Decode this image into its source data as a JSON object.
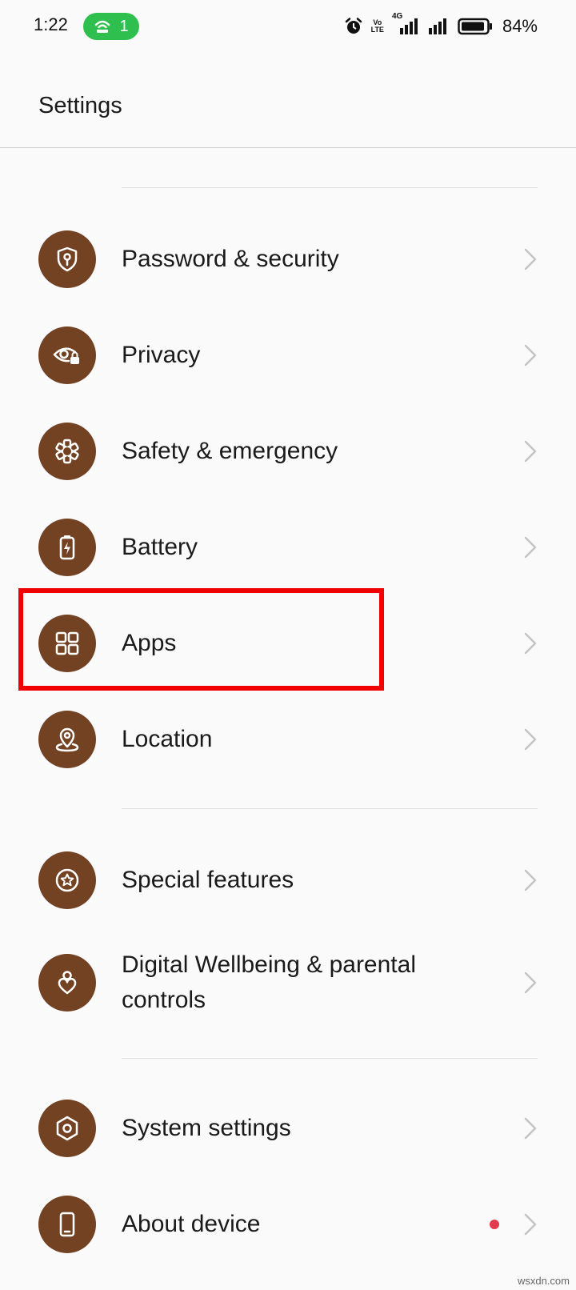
{
  "status_bar": {
    "time": "1:22",
    "hotspot_count": "1",
    "volte_top": "Vo",
    "volte_bottom": "LTE",
    "network": "4G",
    "battery_percent": "84%",
    "pill_color": "#2fbf4f"
  },
  "header": {
    "title": "Settings"
  },
  "settings": {
    "accent_color": "#734223",
    "items": [
      {
        "label": "Password & security",
        "icon": "shield-key-icon"
      },
      {
        "label": "Privacy",
        "icon": "eye-lock-icon"
      },
      {
        "label": "Safety & emergency",
        "icon": "asterisk-icon"
      },
      {
        "label": "Battery",
        "icon": "battery-bolt-icon"
      },
      {
        "label": "Apps",
        "icon": "apps-grid-icon"
      },
      {
        "label": "Location",
        "icon": "location-pin-icon"
      },
      {
        "label": "Special features",
        "icon": "star-circle-icon"
      },
      {
        "label": "Digital Wellbeing & parental controls",
        "icon": "heart-person-icon"
      },
      {
        "label": "System settings",
        "icon": "hexagon-gear-icon"
      },
      {
        "label": "About device",
        "icon": "phone-icon"
      }
    ]
  },
  "highlight": {
    "target": "Apps",
    "color": "#f00000"
  },
  "watermark": "wsxdn.com"
}
